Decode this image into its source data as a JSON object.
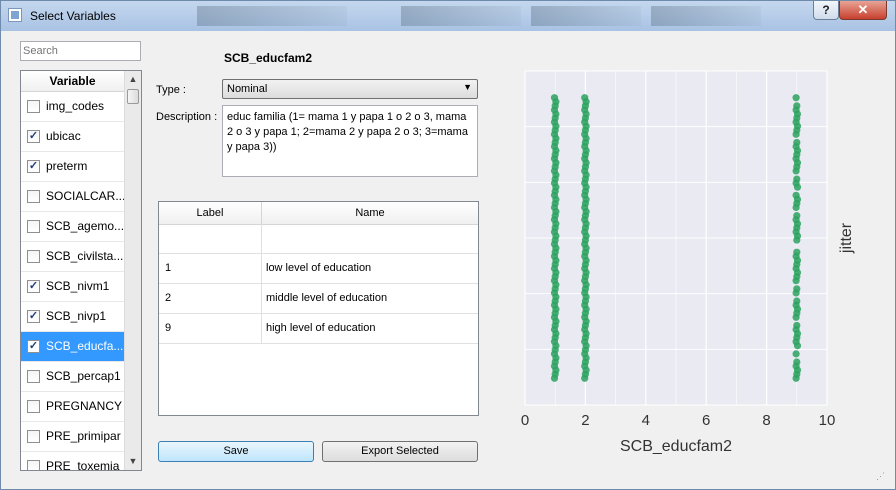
{
  "window": {
    "title": "Select Variables",
    "help_label": "?",
    "close_label": "✕"
  },
  "search": {
    "placeholder": "Search"
  },
  "variable_list": {
    "header": "Variable",
    "items": [
      {
        "label": "img_codes",
        "checked": false,
        "selected": false
      },
      {
        "label": "ubicac",
        "checked": true,
        "selected": false
      },
      {
        "label": "preterm",
        "checked": true,
        "selected": false
      },
      {
        "label": "SOCIALCAR...",
        "checked": false,
        "selected": false
      },
      {
        "label": "SCB_agemo...",
        "checked": false,
        "selected": false
      },
      {
        "label": "SCB_civilsta...",
        "checked": false,
        "selected": false
      },
      {
        "label": "SCB_nivm1",
        "checked": true,
        "selected": false
      },
      {
        "label": "SCB_nivp1",
        "checked": true,
        "selected": false
      },
      {
        "label": "SCB_educfa...",
        "checked": true,
        "selected": true
      },
      {
        "label": "SCB_percap1",
        "checked": false,
        "selected": false
      },
      {
        "label": "PREGNANCY",
        "checked": false,
        "selected": false
      },
      {
        "label": "PRE_primipar",
        "checked": false,
        "selected": false
      },
      {
        "label": "PRE_toxemia",
        "checked": false,
        "selected": false
      }
    ]
  },
  "details": {
    "variable_name": "SCB_educfam2",
    "type_label": "Type :",
    "type_value": "Nominal",
    "description_label": "Description :",
    "description": "educ familia (1= mama 1 y papa 1 o 2 o 3, mama 2 o 3 y papa 1; 2=mama 2 y papa 2 o 3; 3=mama y papa 3))"
  },
  "labels_table": {
    "columns": [
      "Label",
      "Name"
    ],
    "rows": [
      {
        "label": "",
        "name": ""
      },
      {
        "label": "1",
        "name": "low level of education"
      },
      {
        "label": "2",
        "name": "middle level of education"
      },
      {
        "label": "9",
        "name": "high level of education"
      }
    ]
  },
  "buttons": {
    "save": "Save",
    "export": "Export Selected"
  },
  "chart_data": {
    "type": "scatter",
    "xlabel": "SCB_educfam2",
    "ylabel": "jitter",
    "xlim": [
      0,
      10
    ],
    "xticks": [
      "0",
      "2",
      "4",
      "6",
      "8",
      "10"
    ],
    "ylim": [
      0,
      1
    ],
    "grid": true,
    "point_color": "#2ca25f",
    "series": [
      {
        "x": 1,
        "y_range": [
          0.08,
          0.92
        ]
      },
      {
        "x": 2,
        "y_range": [
          0.08,
          0.92
        ]
      },
      {
        "x": 9,
        "y_range": [
          0.08,
          0.92
        ]
      }
    ]
  }
}
